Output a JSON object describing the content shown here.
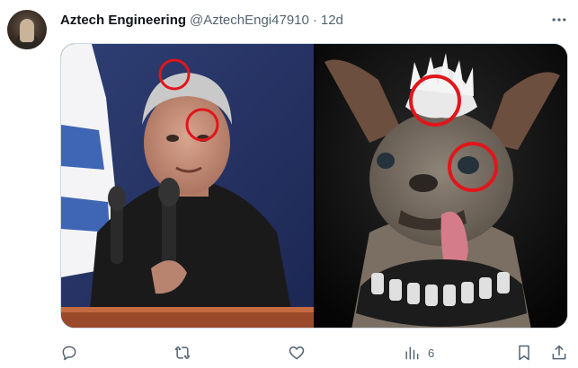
{
  "tweet": {
    "author": {
      "display_name": "Aztech Engineering",
      "handle": "@AztechEngi47910",
      "avatar": "avatar-photo"
    },
    "separator": "·",
    "timestamp": "12d",
    "more_icon": "more-horizontal-icon",
    "media": {
      "left_image": "man-in-black-shirt-at-podium-with-flag",
      "right_image": "hairless-dog-with-studded-collar",
      "annotation_color": "#e0161b"
    },
    "actions": {
      "reply_icon": "reply-icon",
      "repost_icon": "repost-icon",
      "like_icon": "like-icon",
      "views_icon": "views-icon",
      "views_count": "6",
      "bookmark_icon": "bookmark-icon",
      "share_icon": "share-icon"
    },
    "colors": {
      "text_primary": "#0f1419",
      "text_secondary": "#536471",
      "border": "#cfd9de"
    }
  }
}
